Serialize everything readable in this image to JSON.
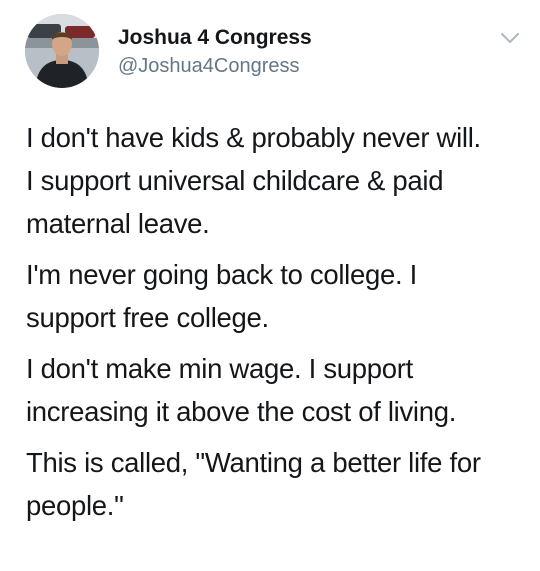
{
  "author": {
    "display_name": "Joshua 4 Congress",
    "handle": "@Joshua4Congress",
    "avatar_icon": "profile-photo"
  },
  "menu": {
    "icon": "chevron-down-icon"
  },
  "tweet": {
    "paragraphs": [
      {
        "lines": [
          "I don't have kids & probably never will.",
          "I support universal childcare & paid",
          "maternal leave."
        ]
      },
      {
        "lines": [
          "I'm never going back to college. I",
          "support free college."
        ]
      },
      {
        "lines": [
          "I don't make min wage. I support",
          "increasing it above the cost of living."
        ]
      },
      {
        "lines": [
          "This is called, \"Wanting a better life for",
          "people.\""
        ]
      }
    ]
  },
  "colors": {
    "text": "#14171a",
    "secondary": "#657786",
    "chevron": "#aab8c2",
    "background": "#ffffff"
  }
}
